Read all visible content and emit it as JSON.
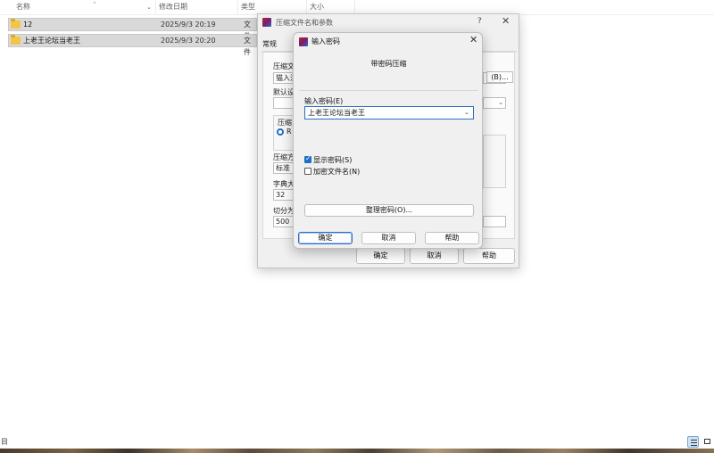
{
  "explorer": {
    "columns": [
      {
        "label": "名称"
      },
      {
        "label": "修改日期"
      },
      {
        "label": "类型"
      },
      {
        "label": "大小"
      }
    ],
    "rows": [
      {
        "name": "12",
        "date": "2025/9/3 20:19",
        "type": "文件"
      },
      {
        "name": "上老王论坛当老王",
        "date": "2025/9/3 20:20",
        "type": "文件"
      }
    ],
    "status_left": "目"
  },
  "back_dialog": {
    "title": "压缩文件名和参数",
    "help": "?",
    "close": "✕",
    "tab_general": "常规",
    "archive_name_label": "压缩文",
    "browse_label": "(B)...",
    "archive_name_value": "猫入注",
    "default_profile_label": "默认设",
    "format_group_label": "压缩",
    "radio_label": "R",
    "method_label": "压缩方",
    "method_value": "标准",
    "dict_label": "字典大",
    "dict_value": "32",
    "split_label": "切分为",
    "split_value": "500",
    "ok_label": "确定",
    "cancel_label": "取消",
    "help_label": "帮助"
  },
  "password_dialog": {
    "title": "输入密码",
    "close": "✕",
    "heading": "带密码压缩",
    "password_label": "输入密码(E)",
    "password_value": "上老王论坛当老王",
    "show_password_label": "显示密码(S)",
    "encrypt_names_label": "加密文件名(N)",
    "show_password_checked": true,
    "encrypt_names_checked": false,
    "manage_label": "整理密码(O)...",
    "ok_label": "确定",
    "cancel_label": "取消",
    "help_label": "帮助"
  }
}
